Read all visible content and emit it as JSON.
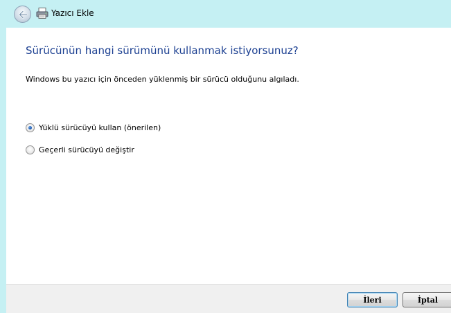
{
  "window": {
    "title": "Yazıcı Ekle"
  },
  "page": {
    "heading": "Sürücünün hangi sürümünü kullanmak istiyorsunuz?",
    "description": "Windows bu yazıcı için önceden yüklenmiş bir sürücü olduğunu algıladı.",
    "options": [
      {
        "label": "Yüklü sürücüyü kullan (önerilen)",
        "selected": true
      },
      {
        "label": "Geçerli sürücüyü değiştir",
        "selected": false
      }
    ]
  },
  "footer": {
    "next_label": "İleri",
    "cancel_label": "İptal"
  },
  "icons": {
    "back": "back-arrow-icon",
    "wizard": "printer-icon"
  },
  "colors": {
    "frame": "#c5f0f3",
    "heading": "#1b3f91"
  }
}
